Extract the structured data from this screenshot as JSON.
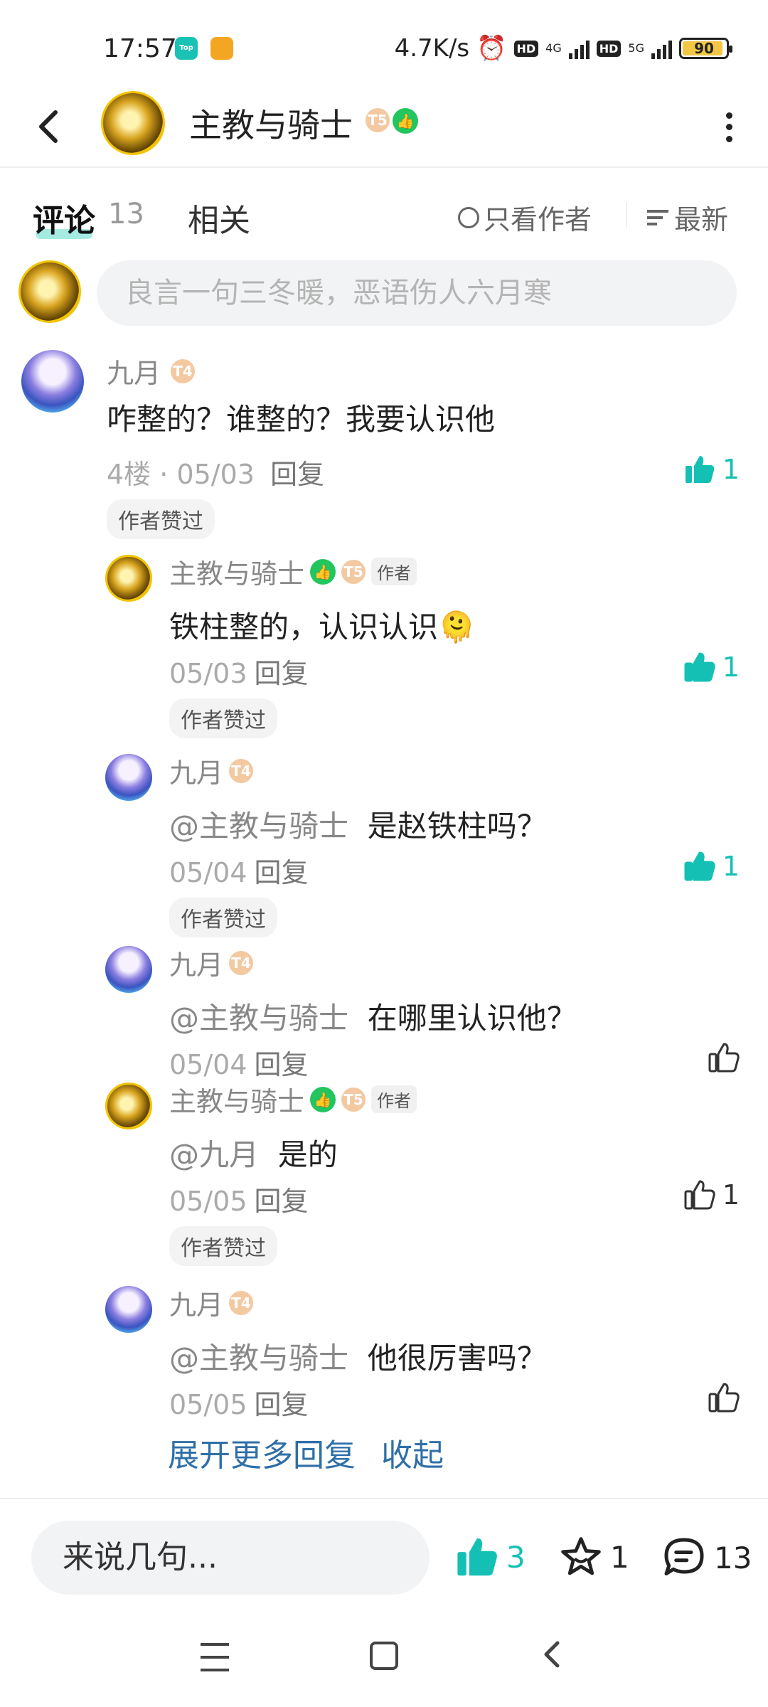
{
  "status_bar": {
    "time": "17:57",
    "app_icon_1": "Top",
    "speed": "4.7K/s",
    "net1": "4G",
    "net2": "5G",
    "hd": "HD",
    "battery": "90"
  },
  "header": {
    "title": "主教与骑士",
    "level_badge": "T5",
    "verified_icon": "thumb-badge"
  },
  "tabs": {
    "comments_label": "评论",
    "comments_count": "13",
    "related_label": "相关",
    "author_only": "只看作者",
    "sort": "最新"
  },
  "comment_input": {
    "placeholder": "良言一句三冬暖，恶语伤人六月寒"
  },
  "main_comment": {
    "name": "九月",
    "level": "T4",
    "text": "咋整的？谁整的？我要认识他",
    "floor": "4楼",
    "date": "05/03",
    "reply_label": "回复",
    "likes": "1",
    "author_liked": "作者赞过"
  },
  "replies": [
    {
      "name": "主教与骑士",
      "is_author": true,
      "level": "T5",
      "author_tag": "作者",
      "mention": "",
      "text": "铁柱整的，认识认识🫠",
      "date": "05/03",
      "reply_label": "回复",
      "likes": "1",
      "liked_active": true,
      "author_liked": "作者赞过"
    },
    {
      "name": "九月",
      "is_author": false,
      "level": "T4",
      "author_tag": "",
      "mention": "@主教与骑士",
      "text": "是赵铁柱吗？",
      "date": "05/04",
      "reply_label": "回复",
      "likes": "1",
      "liked_active": true,
      "author_liked": "作者赞过"
    },
    {
      "name": "九月",
      "is_author": false,
      "level": "T4",
      "author_tag": "",
      "mention": "@主教与骑士",
      "text": "在哪里认识他？",
      "date": "05/04",
      "reply_label": "回复",
      "likes": "",
      "liked_active": false,
      "author_liked": ""
    },
    {
      "name": "主教与骑士",
      "is_author": true,
      "level": "T5",
      "author_tag": "作者",
      "mention": "@九月",
      "text": "是的",
      "date": "05/05",
      "reply_label": "回复",
      "likes": "1",
      "liked_active": false,
      "author_liked": "作者赞过"
    },
    {
      "name": "九月",
      "is_author": false,
      "level": "T4",
      "author_tag": "",
      "mention": "@主教与骑士",
      "text": "他很厉害吗？",
      "date": "05/05",
      "reply_label": "回复",
      "likes": "",
      "liked_active": false,
      "author_liked": ""
    }
  ],
  "expand": {
    "more": "展开更多回复",
    "collapse": "收起"
  },
  "bottom_bar": {
    "input_placeholder": "来说几句...",
    "likes": "3",
    "favorites": "1",
    "comments": "13"
  },
  "colors": {
    "accent": "#14c0b4",
    "link": "#2f6fa8",
    "verified": "#22c55e"
  }
}
